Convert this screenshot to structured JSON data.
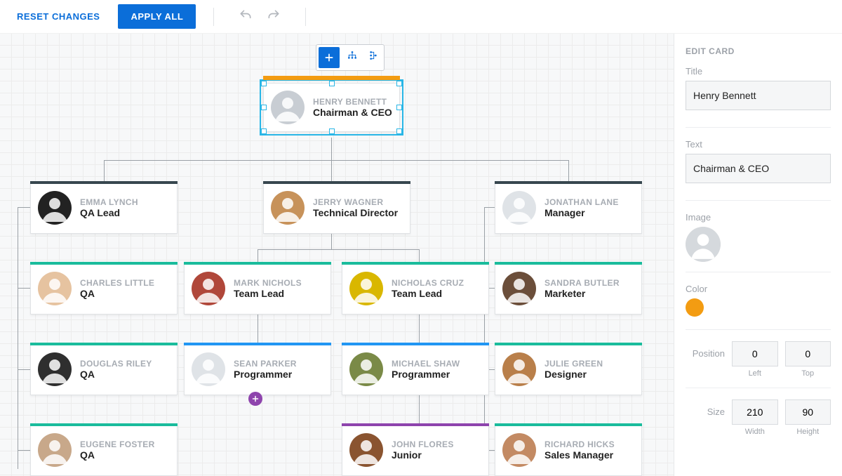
{
  "toolbar": {
    "reset_label": "RESET CHANGES",
    "apply_label": "APPLY ALL"
  },
  "mini_toolbar": {
    "add": "+"
  },
  "colors": {
    "orange": "#f39c12",
    "slate": "#37474f",
    "teal": "#1abc9c",
    "blue": "#2196f3",
    "purple": "#8e44ad"
  },
  "cards": {
    "ceo": {
      "name": "HENRY BENNETT",
      "role": "Chairman & CEO",
      "bar": "orange",
      "avatar": "#c8cdd3"
    },
    "qa_lead": {
      "name": "EMMA LYNCH",
      "role": "QA Lead",
      "bar": "slate",
      "avatar": "#222"
    },
    "techdir": {
      "name": "JERRY WAGNER",
      "role": "Technical Director",
      "bar": "slate",
      "avatar": "#c7925a"
    },
    "manager": {
      "name": "JONATHAN LANE",
      "role": "Manager",
      "bar": "slate",
      "avatar": "#dfe3e7"
    },
    "charles": {
      "name": "CHARLES LITTLE",
      "role": "QA",
      "bar": "teal",
      "avatar": "#e6c3a0"
    },
    "mark": {
      "name": "MARK NICHOLS",
      "role": "Team Lead",
      "bar": "teal",
      "avatar": "#b0473a"
    },
    "nick": {
      "name": "NICHOLAS CRUZ",
      "role": "Team Lead",
      "bar": "teal",
      "avatar": "#d9b700"
    },
    "sandra": {
      "name": "SANDRA BUTLER",
      "role": "Marketer",
      "bar": "teal",
      "avatar": "#6b4e3a"
    },
    "douglas": {
      "name": "DOUGLAS RILEY",
      "role": "QA",
      "bar": "teal",
      "avatar": "#2f2f2f"
    },
    "sean": {
      "name": "SEAN PARKER",
      "role": "Programmer",
      "bar": "blue",
      "avatar": "#dfe3e7"
    },
    "michael": {
      "name": "MICHAEL SHAW",
      "role": "Programmer",
      "bar": "blue",
      "avatar": "#7a8a47"
    },
    "julie": {
      "name": "JULIE GREEN",
      "role": "Designer",
      "bar": "teal",
      "avatar": "#b97f4a"
    },
    "eugene": {
      "name": "EUGENE FOSTER",
      "role": "QA",
      "bar": "teal",
      "avatar": "#c8a88a"
    },
    "john": {
      "name": "JOHN FLORES",
      "role": "Junior",
      "bar": "purple",
      "avatar": "#8a5430"
    },
    "richard": {
      "name": "RICHARD HICKS",
      "role": "Sales Manager",
      "bar": "teal",
      "avatar": "#c38a63"
    }
  },
  "panel": {
    "heading": "EDIT CARD",
    "title_label": "Title",
    "title_value": "Henry Bennett",
    "text_label": "Text",
    "text_value": "Chairman & CEO",
    "image_label": "Image",
    "color_label": "Color",
    "color_value": "#f39c12",
    "position_label": "Position",
    "left_value": "0",
    "left_label": "Left",
    "top_value": "0",
    "top_label": "Top",
    "size_label": "Size",
    "width_value": "210",
    "width_label": "Width",
    "height_value": "90",
    "height_label": "Height"
  }
}
